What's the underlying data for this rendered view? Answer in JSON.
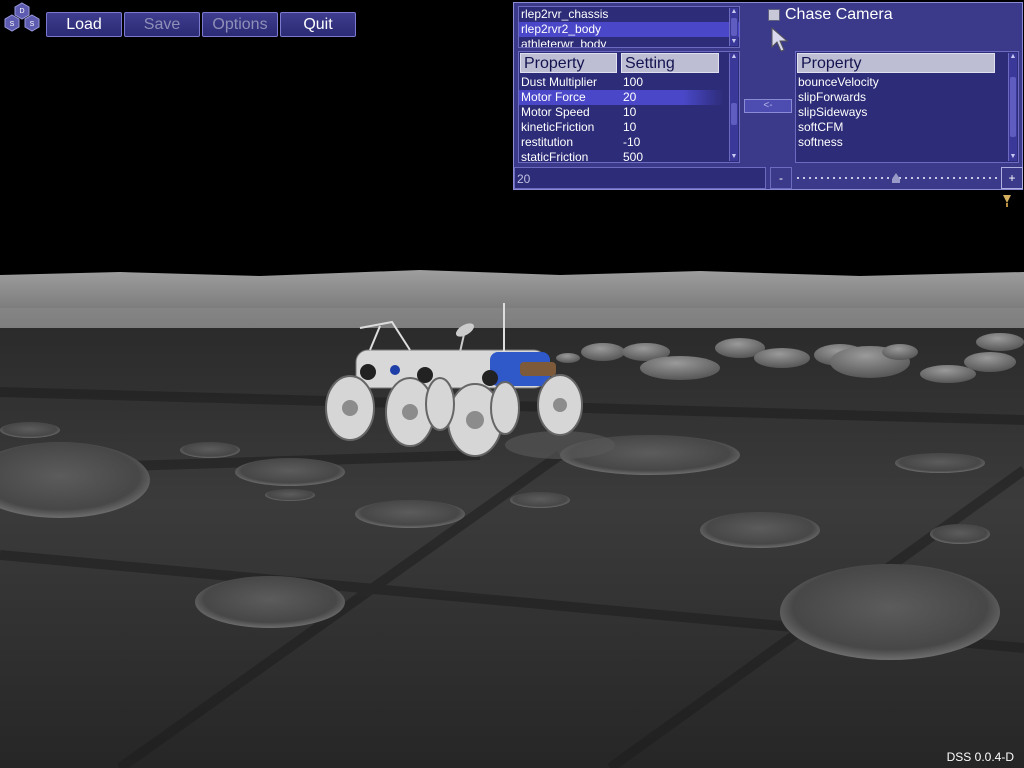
{
  "logo": {
    "letters": [
      "D",
      "S",
      "S"
    ]
  },
  "toolbar": {
    "buttons": [
      {
        "label": "Load",
        "enabled": true
      },
      {
        "label": "Save",
        "enabled": false
      },
      {
        "label": "Options",
        "enabled": false
      },
      {
        "label": "Quit",
        "enabled": true
      }
    ]
  },
  "panel": {
    "bodies": [
      "rlep2rvr_chassis",
      "rlep2rvr2_body",
      "athleterwr_body"
    ],
    "selected_body": "rlep2rvr2_body",
    "chase_camera": {
      "label": "Chase Camera",
      "checked": false
    },
    "left_table": {
      "headers": [
        "Property",
        "Setting"
      ],
      "rows": [
        {
          "property": "Dust Multiplier",
          "setting": "100"
        },
        {
          "property": "Motor Force",
          "setting": "20",
          "selected": true
        },
        {
          "property": "Motor Speed",
          "setting": "10"
        },
        {
          "property": "kineticFriction",
          "setting": "10"
        },
        {
          "property": "restitution",
          "setting": "-10"
        },
        {
          "property": "staticFriction",
          "setting": "500"
        }
      ]
    },
    "move_button": "<-",
    "right_table": {
      "header": "Property",
      "rows": [
        "bounceVelocity",
        "slipForwards",
        "slipSideways",
        "softCFM",
        "softness"
      ]
    },
    "value": "20",
    "minus": "-",
    "plus": "+"
  },
  "version": "DSS 0.0.4-D",
  "colors": {
    "panel_bg": "#3b3a8a",
    "selection": "#4a48c8",
    "sky": "#000000",
    "ground": "#3a3a3a"
  }
}
